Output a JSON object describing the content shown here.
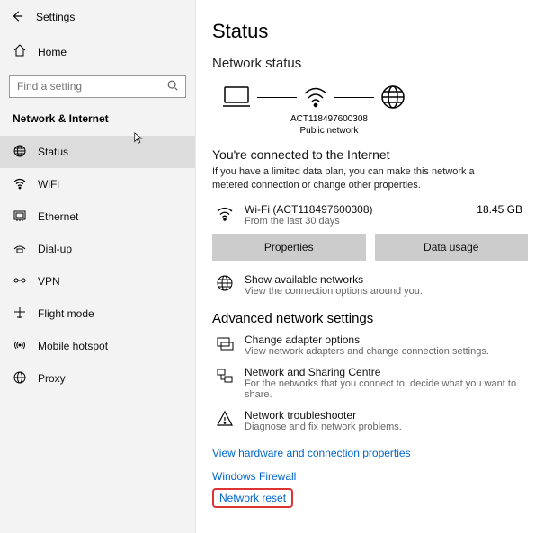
{
  "window": {
    "title": "Settings"
  },
  "sidebar": {
    "home": "Home",
    "search_placeholder": "Find a setting",
    "section": "Network & Internet",
    "items": [
      {
        "id": "status",
        "label": "Status",
        "selected": true
      },
      {
        "id": "wifi",
        "label": "WiFi"
      },
      {
        "id": "ethernet",
        "label": "Ethernet"
      },
      {
        "id": "dialup",
        "label": "Dial-up"
      },
      {
        "id": "vpn",
        "label": "VPN"
      },
      {
        "id": "flightmode",
        "label": "Flight mode"
      },
      {
        "id": "hotspot",
        "label": "Mobile hotspot"
      },
      {
        "id": "proxy",
        "label": "Proxy"
      }
    ]
  },
  "page": {
    "title": "Status",
    "subtitle": "Network status",
    "diagram": {
      "ssid": "ACT118497600308",
      "type": "Public network"
    },
    "connected_heading": "You're connected to the Internet",
    "connected_hint": "If you have a limited data plan, you can make this network a metered connection or change other properties.",
    "connection": {
      "name": "Wi-Fi (ACT118497600308)",
      "meta": "From the last 30 days",
      "usage": "18.45 GB"
    },
    "buttons": {
      "properties": "Properties",
      "data_usage": "Data usage"
    },
    "show_networks": {
      "title": "Show available networks",
      "sub": "View the connection options around you."
    },
    "advanced_heading": "Advanced network settings",
    "adapter": {
      "title": "Change adapter options",
      "sub": "View network adapters and change connection settings."
    },
    "sharing": {
      "title": "Network and Sharing Centre",
      "sub": "For the networks that you connect to, decide what you want to share."
    },
    "troubleshoot": {
      "title": "Network troubleshooter",
      "sub": "Diagnose and fix network problems."
    },
    "links": {
      "hw": "View hardware and connection properties",
      "fw": "Windows Firewall",
      "reset": "Network reset"
    }
  }
}
